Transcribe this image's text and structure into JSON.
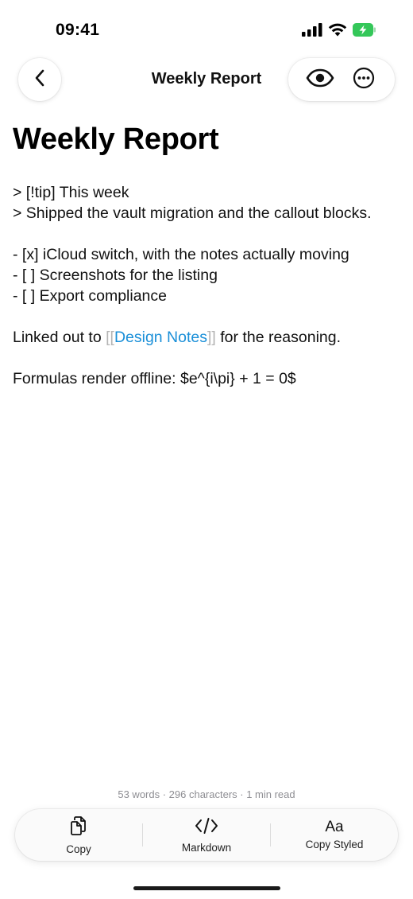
{
  "status_bar": {
    "time": "09:41",
    "icons": [
      "cellular-signal-icon",
      "wifi-icon",
      "battery-charging-icon"
    ],
    "battery_color": "#34c759"
  },
  "nav": {
    "back_icon": "chevron-left-icon",
    "title": "Weekly Report",
    "preview_icon": "eye-icon",
    "more_icon": "ellipsis-circle-icon"
  },
  "document": {
    "title": "Weekly Report",
    "callout_line1": "> [!tip] This week",
    "callout_line2": "> Shipped the vault migration and the callout blocks.",
    "task1": "- [x] iCloud switch, with the notes actually moving",
    "task2": "- [ ] Screenshots for the listing",
    "task3": "- [ ] Export compliance",
    "link_prefix": "Linked out to ",
    "link_open": "[[",
    "link_text": "Design Notes",
    "link_close": "]]",
    "link_suffix": " for the reasoning.",
    "formula_line": "Formulas render offline: $e^{i\\pi} + 1 = 0$",
    "link_color": "#1a8fd8"
  },
  "stats": "53 words · 296 characters · 1 min read",
  "toolbar": {
    "copy_label": "Copy",
    "markdown_label": "Markdown",
    "styled_icon_text": "Aa",
    "styled_label": "Copy Styled"
  }
}
